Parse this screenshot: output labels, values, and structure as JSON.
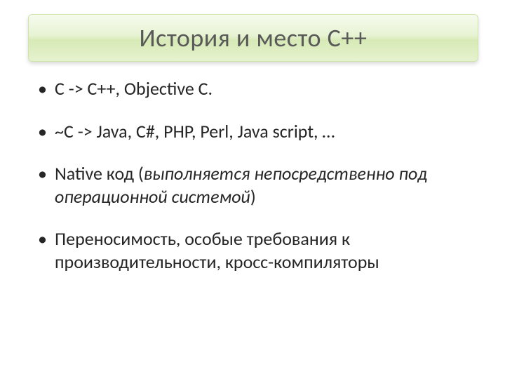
{
  "title": "История и место C++",
  "bullets": [
    "C -> C++, Objective C.",
    "~С -> Java, C#, PHP, Perl, Java script, …",
    "",
    "Переносимость, особые требования к производительности, кросс-компиляторы"
  ],
  "bullet3": {
    "prefix": "Native код (",
    "italic": "выполняется непосредственно под операционной системой",
    "suffix": ")"
  }
}
